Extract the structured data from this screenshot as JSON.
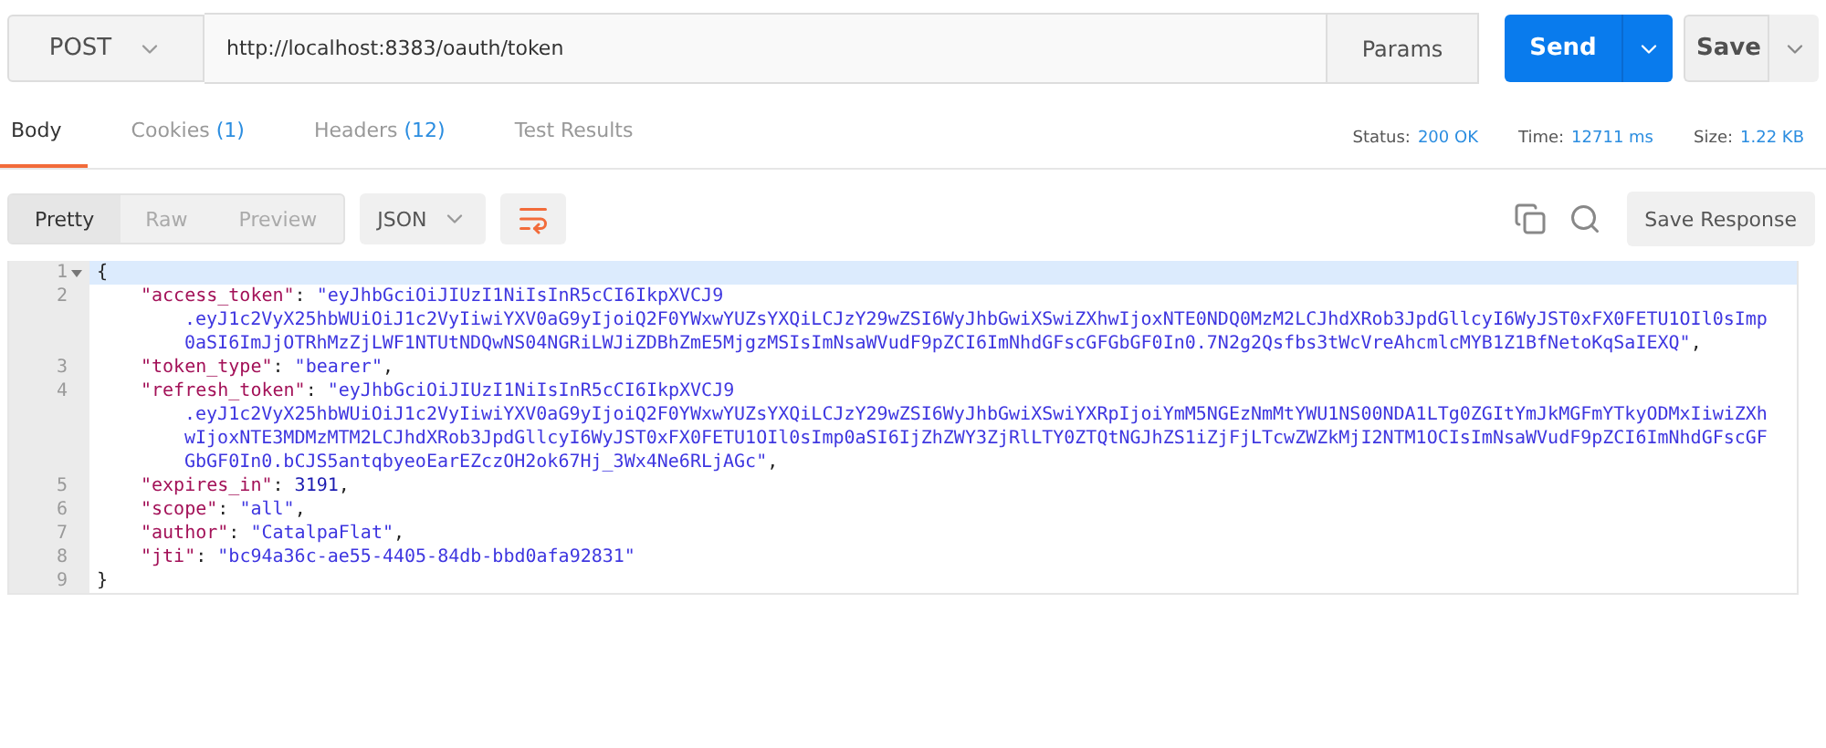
{
  "request": {
    "method": "POST",
    "url": "http://localhost:8383/oauth/token",
    "params": "Params",
    "send": "Send",
    "save": "Save"
  },
  "response_tabs": [
    {
      "label": "Body",
      "selected": true
    },
    {
      "label": "Cookies",
      "count": "(1)",
      "selected": false
    },
    {
      "label": "Headers",
      "count": "(12)",
      "selected": false
    },
    {
      "label": "Test Results",
      "selected": false
    }
  ],
  "stats": [
    {
      "label": "Status:",
      "value": "200 OK"
    },
    {
      "label": "Time:",
      "value": "12711 ms"
    },
    {
      "label": "Size:",
      "value": "1.22 KB"
    }
  ],
  "view_modes": [
    {
      "label": "Pretty",
      "selected": true
    },
    {
      "label": "Raw",
      "selected": false
    },
    {
      "label": "Preview",
      "selected": false
    }
  ],
  "format": "JSON",
  "save_response": "Save Response",
  "code_lines": [
    {
      "number": "1",
      "kind": "open",
      "active": true,
      "segments": [
        {
          "kind": "punct",
          "text": "{"
        }
      ]
    },
    {
      "number": "2",
      "kind": "entry",
      "active": false,
      "segments": [
        {
          "kind": "key",
          "text": "\"access_token\""
        },
        {
          "kind": "punct",
          "text": ": "
        },
        {
          "kind": "string",
          "text": "\"eyJhbGciOiJIUzI1NiIsInR5cCI6IkpXVCJ9"
        }
      ]
    },
    {
      "kind": "wrap",
      "active": false,
      "segments": [
        {
          "kind": "string",
          "text": ".eyJ1c2VyX25hbWUiOiJ1c2VyIiwiYXV0aG9yIjoiQ2F0YWxwYUZsYXQiLCJzY29wZSI6WyJhbGwiXSwiZXhwIjoxNTE0NDQ0MzM2LCJhdXRob3JpdGllcyI6WyJST0xFX0FETU1OIl0sImp"
        }
      ]
    },
    {
      "kind": "wrap",
      "active": false,
      "segments": [
        {
          "kind": "string",
          "text": "0aSI6ImJjOTRhMzZjLWF1NTUtNDQwNS04NGRiLWJiZDBhZmE5MjgzMSIsImNsaWVudF9pZCI6ImNhdGFscGFGbGF0In0.7N2g2Qsfbs3tWcVreAhcmlcMYB1Z1BfNetoKqSaIEXQ\""
        },
        {
          "kind": "punct",
          "text": ","
        }
      ]
    },
    {
      "number": "3",
      "kind": "entry",
      "active": false,
      "segments": [
        {
          "kind": "key",
          "text": "\"token_type\""
        },
        {
          "kind": "punct",
          "text": ": "
        },
        {
          "kind": "string",
          "text": "\"bearer\""
        },
        {
          "kind": "punct",
          "text": ","
        }
      ]
    },
    {
      "number": "4",
      "kind": "entry",
      "active": false,
      "segments": [
        {
          "kind": "key",
          "text": "\"refresh_token\""
        },
        {
          "kind": "punct",
          "text": ": "
        },
        {
          "kind": "string",
          "text": "\"eyJhbGciOiJIUzI1NiIsInR5cCI6IkpXVCJ9"
        }
      ]
    },
    {
      "kind": "wrap",
      "active": false,
      "segments": [
        {
          "kind": "string",
          "text": ".eyJ1c2VyX25hbWUiOiJ1c2VyIiwiYXV0aG9yIjoiQ2F0YWxwYUZsYXQiLCJzY29wZSI6WyJhbGwiXSwiYXRpIjoiYmM5NGEzNmMtYWU1NS00NDA1LTg0ZGItYmJkMGFmYTkyODMxIiwiZXh"
        }
      ]
    },
    {
      "kind": "wrap",
      "active": false,
      "segments": [
        {
          "kind": "string",
          "text": "wIjoxNTE3MDMzMTM2LCJhdXRob3JpdGllcyI6WyJST0xFX0FETU1OIl0sImp0aSI6IjZhZWY3ZjRlLTY0ZTQtNGJhZS1iZjFjLTcwZWZkMjI2NTM1OCIsImNsaWVudF9pZCI6ImNhdGFscGF"
        }
      ]
    },
    {
      "kind": "wrap",
      "active": false,
      "segments": [
        {
          "kind": "string",
          "text": "GbGF0In0.bCJS5antqbyeoEarEZczOH2ok67Hj_3Wx4Ne6RLjAGc\""
        },
        {
          "kind": "punct",
          "text": ","
        }
      ]
    },
    {
      "number": "5",
      "kind": "entry",
      "active": false,
      "segments": [
        {
          "kind": "key",
          "text": "\"expires_in\""
        },
        {
          "kind": "punct",
          "text": ": "
        },
        {
          "kind": "number",
          "text": "3191"
        },
        {
          "kind": "punct",
          "text": ","
        }
      ]
    },
    {
      "number": "6",
      "kind": "entry",
      "active": false,
      "segments": [
        {
          "kind": "key",
          "text": "\"scope\""
        },
        {
          "kind": "punct",
          "text": ": "
        },
        {
          "kind": "string",
          "text": "\"all\""
        },
        {
          "kind": "punct",
          "text": ","
        }
      ]
    },
    {
      "number": "7",
      "kind": "entry",
      "active": false,
      "segments": [
        {
          "kind": "key",
          "text": "\"author\""
        },
        {
          "kind": "punct",
          "text": ": "
        },
        {
          "kind": "string",
          "text": "\"CatalpaFlat\""
        },
        {
          "kind": "punct",
          "text": ","
        }
      ]
    },
    {
      "number": "8",
      "kind": "entry",
      "active": false,
      "segments": [
        {
          "kind": "key",
          "text": "\"jti\""
        },
        {
          "kind": "punct",
          "text": ": "
        },
        {
          "kind": "string",
          "text": "\"bc94a36c-ae55-4405-84db-bbd0afa92831\""
        }
      ]
    },
    {
      "number": "9",
      "kind": "close",
      "active": false,
      "segments": [
        {
          "kind": "punct",
          "text": "}"
        }
      ]
    }
  ]
}
